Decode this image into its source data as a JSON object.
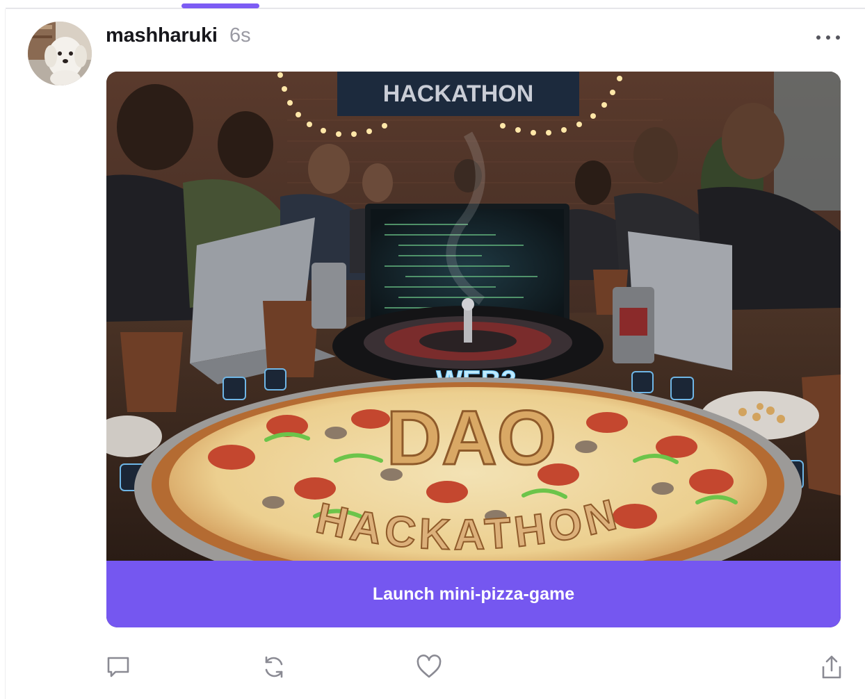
{
  "post": {
    "username": "mashharuki",
    "timestamp": "6s",
    "avatar_icon": "dog-avatar",
    "more_icon": "more-dots-icon"
  },
  "frame": {
    "image_icon": "hackathon-pizza-image",
    "banner_text": "HACKATHON",
    "roulette_text": "WEB3",
    "pizza_big_text": "DAO",
    "pizza_arc_text": "HACKATHON",
    "button_label": "Launch mini-pizza-game"
  },
  "actions": {
    "reply_icon": "comment-icon",
    "recast_icon": "recast-icon",
    "like_icon": "heart-icon",
    "share_icon": "share-icon"
  },
  "colors": {
    "accent": "#7557f0",
    "indicator": "#7c5cf4",
    "timestamp": "#9a9aa3",
    "icon": "#8a8a93"
  }
}
